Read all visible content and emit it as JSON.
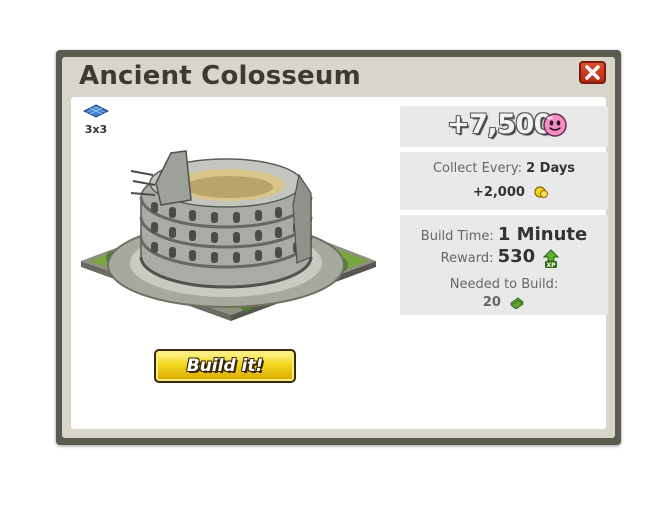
{
  "dialog": {
    "title": "Ancient Colosseum",
    "close_icon": "close-x-icon"
  },
  "building": {
    "size": "3x3",
    "size_icon": "grid-tile-icon",
    "image": "colosseum-building-image"
  },
  "actions": {
    "build_label": "Build it!"
  },
  "stats": {
    "value": "+7,500",
    "value_icon": "pink-blob-icon",
    "collect_label": "Collect Every:",
    "collect_value": "2 Days",
    "collect_amount": "+2,000",
    "collect_amount_icon": "coin-icon",
    "build_time_label": "Build Time:",
    "build_time_value": "1 Minute",
    "reward_label": "Reward:",
    "reward_value": "530",
    "reward_icon": "xp-icon",
    "needed_label": "Needed to Build:",
    "needed_value": "20",
    "needed_icon": "cash-icon"
  },
  "colors": {
    "frame": "#5b5b50",
    "header": "#d8d6cb",
    "panel": "#e9e9e9",
    "button": "#f3d51f",
    "close": "#c8361c"
  }
}
